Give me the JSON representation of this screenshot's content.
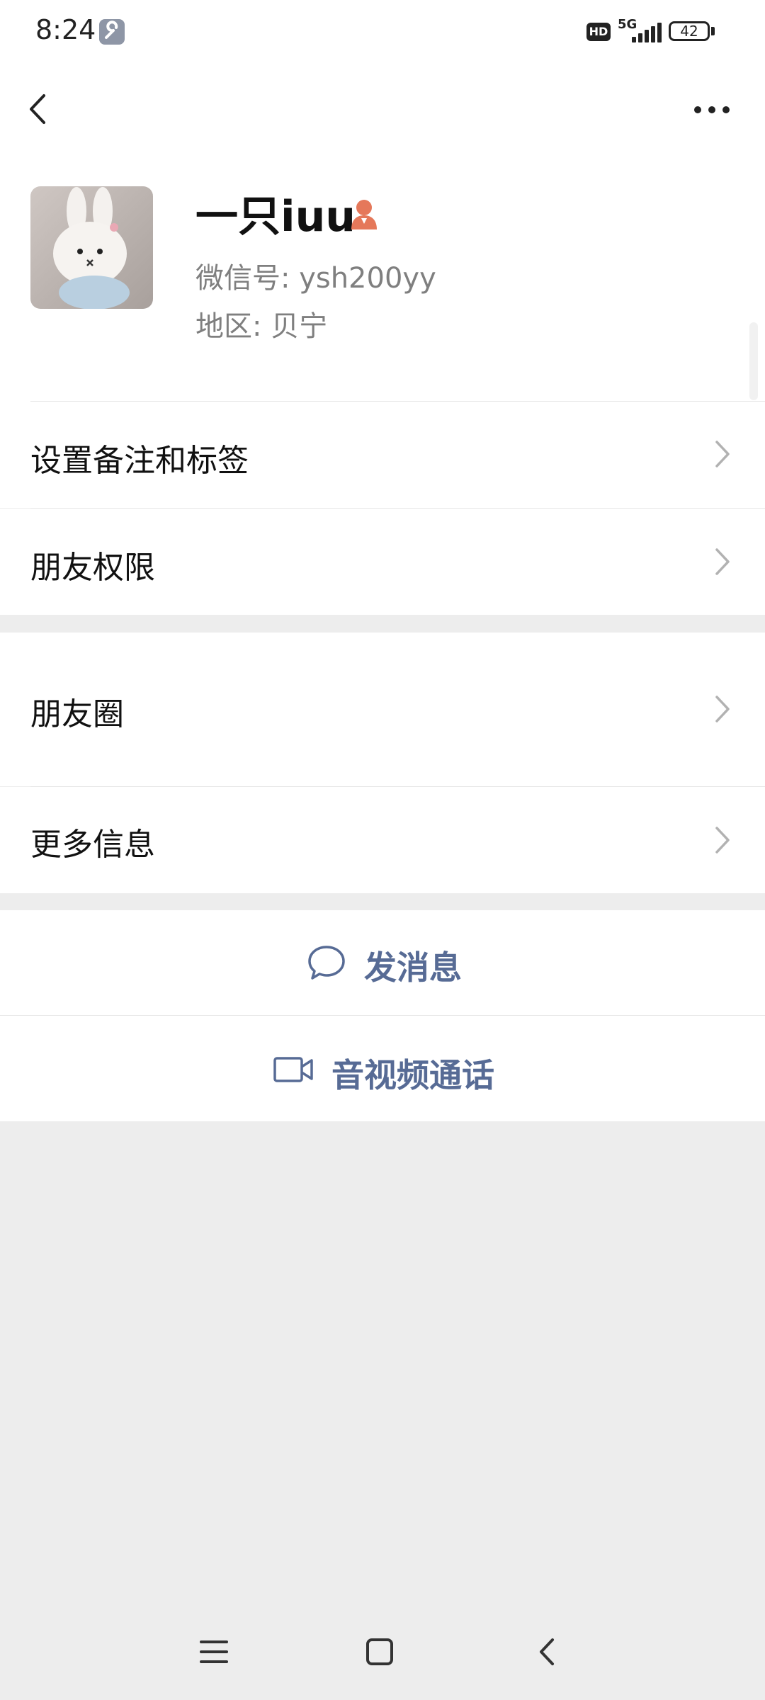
{
  "status_bar": {
    "time": "8:24",
    "hd_badge": "HD",
    "network": "5G",
    "battery": "42",
    "icons": [
      "wrench-icon",
      "signal-icon",
      "battery-icon"
    ]
  },
  "nav": {
    "back_icon": "back-arrow-icon",
    "more_icon": "more-dots-icon"
  },
  "profile": {
    "name": "一只iuu",
    "gender_icon": "female-icon",
    "gender_color": "#e5785a",
    "wechat_id": "微信号: ysh200yy",
    "region": "地区: 贝宁"
  },
  "menu": {
    "remark": "设置备注和标签",
    "permissions": "朋友权限",
    "moments": "朋友圈",
    "more_info": "更多信息"
  },
  "actions": {
    "message": "发消息",
    "call": "音视频通话",
    "accent": "#576b95"
  },
  "system_nav": {
    "icons": [
      "menu-icon",
      "home-icon",
      "back-icon"
    ]
  }
}
